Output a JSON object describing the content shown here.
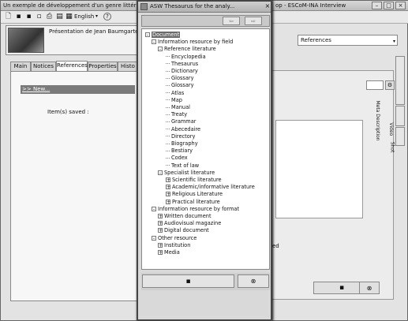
{
  "main_window": {
    "title_left": "Un exemple de développement d'un genre littéra",
    "title_right": "op - ESCoM-INA Interview",
    "toolbar": {
      "language": "English"
    },
    "header": {
      "person_label": "Présentation de Jean Baumgarten"
    },
    "tabs": [
      "Main",
      "Notices",
      "References",
      "Properties",
      "Histo"
    ],
    "active_tab": "References",
    "left_pane": {
      "new_link": ">> New...",
      "items_saved": "Item(s) saved :"
    },
    "reference_select": "References",
    "partial_text": "ed",
    "side_tabs": [
      "Meta Description",
      "Video",
      "Shot"
    ]
  },
  "thesaurus": {
    "title": "ASW Thesaurus for the analy...",
    "tree": [
      {
        "level": 0,
        "toggle": "-",
        "label": "Document",
        "selected": true
      },
      {
        "level": 1,
        "toggle": "-",
        "label": "Information resource by field"
      },
      {
        "level": 2,
        "toggle": "-",
        "label": "Reference literature"
      },
      {
        "level": 3,
        "toggle": "",
        "label": "Encyclopedia"
      },
      {
        "level": 3,
        "toggle": "",
        "label": "Thesaurus"
      },
      {
        "level": 3,
        "toggle": "",
        "label": "Dictionary"
      },
      {
        "level": 3,
        "toggle": "",
        "label": "Glossary"
      },
      {
        "level": 3,
        "toggle": "",
        "label": "Glossary"
      },
      {
        "level": 3,
        "toggle": "",
        "label": "Atlas"
      },
      {
        "level": 3,
        "toggle": "",
        "label": "Map"
      },
      {
        "level": 3,
        "toggle": "",
        "label": "Manual"
      },
      {
        "level": 3,
        "toggle": "",
        "label": "Treaty"
      },
      {
        "level": 3,
        "toggle": "",
        "label": "Grammar"
      },
      {
        "level": 3,
        "toggle": "",
        "label": "Abecedaire"
      },
      {
        "level": 3,
        "toggle": "",
        "label": "Directory"
      },
      {
        "level": 3,
        "toggle": "",
        "label": "Biography"
      },
      {
        "level": 3,
        "toggle": "",
        "label": "Bestiary"
      },
      {
        "level": 3,
        "toggle": "",
        "label": "Codex"
      },
      {
        "level": 3,
        "toggle": "",
        "label": "Text of law"
      },
      {
        "level": 2,
        "toggle": "-",
        "label": "Specialist literature"
      },
      {
        "level": 3,
        "toggle": "+",
        "label": "Scientific literature"
      },
      {
        "level": 3,
        "toggle": "+",
        "label": "Academic/informative literature"
      },
      {
        "level": 3,
        "toggle": "+",
        "label": "Religious Literature"
      },
      {
        "level": 3,
        "toggle": "+",
        "label": "Practical literature"
      },
      {
        "level": 1,
        "toggle": "-",
        "label": "Information resource by format"
      },
      {
        "level": 2,
        "toggle": "+",
        "label": "Written document"
      },
      {
        "level": 2,
        "toggle": "+",
        "label": "Audiovisual magazine"
      },
      {
        "level": 2,
        "toggle": "+",
        "label": "Digital document"
      },
      {
        "level": 1,
        "toggle": "-",
        "label": "Other resource"
      },
      {
        "level": 2,
        "toggle": "+",
        "label": "Institution"
      },
      {
        "level": 2,
        "toggle": "+",
        "label": "Media"
      }
    ]
  }
}
